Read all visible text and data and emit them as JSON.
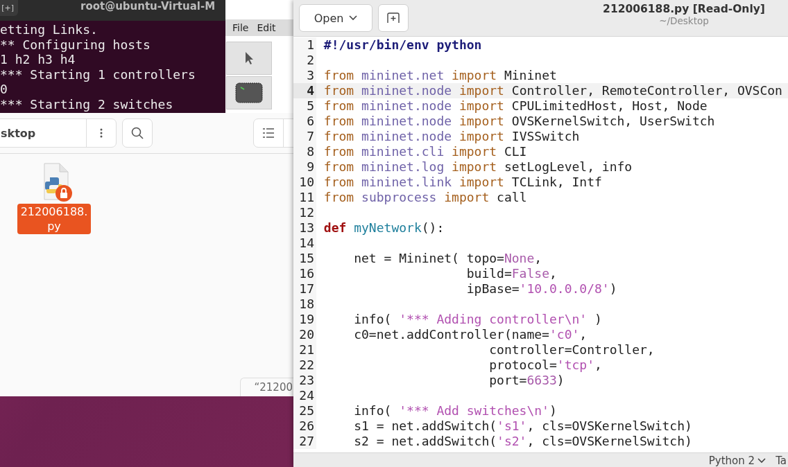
{
  "terminal": {
    "title": "root@ubuntu-Virtual-M",
    "new_tab_button": "[+]",
    "lines": [
      "etting Links.",
      "** Configuring hosts",
      "1 h2 h3 h4",
      "*** Starting 1 controllers",
      "0",
      "*** Starting 2 switches"
    ]
  },
  "miniedit": {
    "menu": [
      "File",
      "Edit"
    ],
    "tools": [
      {
        "kind": "select",
        "selected": false
      },
      {
        "kind": "switch",
        "selected": false
      }
    ]
  },
  "file_manager": {
    "path": "sktop",
    "files": [
      {
        "name": "212006188.\npy",
        "selected": true,
        "locked": true
      }
    ],
    "status_overlay": "“21200"
  },
  "editor": {
    "open_button": "Open",
    "title": "212006188.py [Read-Only]",
    "subtitle": "~/Desktop",
    "lines": [
      {
        "number": "1",
        "current": false,
        "segments": [
          {
            "kind": "shebang",
            "text": "#!/usr/bin/env python"
          }
        ]
      },
      {
        "number": "2",
        "current": false
      },
      {
        "number": "3",
        "current": false,
        "segments": [
          {
            "kind": "keyword",
            "text": "from"
          },
          {
            "kind": "module",
            "text": " mininet.net"
          },
          {
            "kind": "keyword",
            "text": " import"
          },
          {
            "kind": "plain",
            "text": " Mininet"
          }
        ]
      },
      {
        "number": "4",
        "current": true,
        "segments": [
          {
            "kind": "keyword",
            "text": "from"
          },
          {
            "kind": "module",
            "text": " mininet.node"
          },
          {
            "kind": "keyword",
            "text": " import"
          },
          {
            "kind": "plain",
            "text": " Controller, RemoteController, OVSCon"
          }
        ]
      },
      {
        "number": "5",
        "current": false,
        "segments": [
          {
            "kind": "keyword",
            "text": "from"
          },
          {
            "kind": "module",
            "text": " mininet.node"
          },
          {
            "kind": "keyword",
            "text": " import"
          },
          {
            "kind": "plain",
            "text": " CPULimitedHost, Host, Node"
          }
        ]
      },
      {
        "number": "6",
        "current": false,
        "segments": [
          {
            "kind": "keyword",
            "text": "from"
          },
          {
            "kind": "module",
            "text": " mininet.node"
          },
          {
            "kind": "keyword",
            "text": " import"
          },
          {
            "kind": "plain",
            "text": " OVSKernelSwitch, UserSwitch"
          }
        ]
      },
      {
        "number": "7",
        "current": false,
        "segments": [
          {
            "kind": "keyword",
            "text": "from"
          },
          {
            "kind": "module",
            "text": " mininet.node"
          },
          {
            "kind": "keyword",
            "text": " import"
          },
          {
            "kind": "plain",
            "text": " IVSSwitch"
          }
        ]
      },
      {
        "number": "8",
        "current": false,
        "segments": [
          {
            "kind": "keyword",
            "text": "from"
          },
          {
            "kind": "module",
            "text": " mininet.cli"
          },
          {
            "kind": "keyword",
            "text": " import"
          },
          {
            "kind": "plain",
            "text": " CLI"
          }
        ]
      },
      {
        "number": "9",
        "current": false,
        "segments": [
          {
            "kind": "keyword",
            "text": "from"
          },
          {
            "kind": "module",
            "text": " mininet.log"
          },
          {
            "kind": "keyword",
            "text": " import"
          },
          {
            "kind": "plain",
            "text": " setLogLevel, info"
          }
        ]
      },
      {
        "number": "10",
        "current": false,
        "segments": [
          {
            "kind": "keyword",
            "text": "from"
          },
          {
            "kind": "module",
            "text": " mininet.link"
          },
          {
            "kind": "keyword",
            "text": " import"
          },
          {
            "kind": "plain",
            "text": " TCLink, Intf"
          }
        ]
      },
      {
        "number": "11",
        "current": false,
        "segments": [
          {
            "kind": "keyword",
            "text": "from"
          },
          {
            "kind": "module",
            "text": " subprocess"
          },
          {
            "kind": "keyword",
            "text": " import"
          },
          {
            "kind": "plain",
            "text": " call"
          }
        ]
      },
      {
        "number": "12",
        "current": false
      },
      {
        "number": "13",
        "current": false,
        "segments": [
          {
            "kind": "def",
            "text": "def"
          },
          {
            "kind": "function",
            "text": " myNetwork"
          },
          {
            "kind": "plain",
            "text": "():"
          }
        ]
      },
      {
        "number": "14",
        "current": false
      },
      {
        "number": "15",
        "current": false,
        "segments": [
          {
            "kind": "plain",
            "text": "    net = Mininet( topo="
          },
          {
            "kind": "constant",
            "text": "None"
          },
          {
            "kind": "plain",
            "text": ","
          }
        ]
      },
      {
        "number": "16",
        "current": false,
        "segments": [
          {
            "kind": "plain",
            "text": "                   build="
          },
          {
            "kind": "constant",
            "text": "False"
          },
          {
            "kind": "plain",
            "text": ","
          }
        ]
      },
      {
        "number": "17",
        "current": false,
        "segments": [
          {
            "kind": "plain",
            "text": "                   ipBase="
          },
          {
            "kind": "string",
            "text": "'10.0.0.0/8'"
          },
          {
            "kind": "plain",
            "text": ")"
          }
        ]
      },
      {
        "number": "18",
        "current": false
      },
      {
        "number": "19",
        "current": false,
        "segments": [
          {
            "kind": "plain",
            "text": "    info( "
          },
          {
            "kind": "string",
            "text": "'*** Adding controller\\n'"
          },
          {
            "kind": "plain",
            "text": " )"
          }
        ]
      },
      {
        "number": "20",
        "current": false,
        "segments": [
          {
            "kind": "plain",
            "text": "    c0=net.addController(name="
          },
          {
            "kind": "string",
            "text": "'c0'"
          },
          {
            "kind": "plain",
            "text": ","
          }
        ]
      },
      {
        "number": "21",
        "current": false,
        "segments": [
          {
            "kind": "plain",
            "text": "                      controller=Controller,"
          }
        ]
      },
      {
        "number": "22",
        "current": false,
        "segments": [
          {
            "kind": "plain",
            "text": "                      protocol="
          },
          {
            "kind": "string",
            "text": "'tcp'"
          },
          {
            "kind": "plain",
            "text": ","
          }
        ]
      },
      {
        "number": "23",
        "current": false,
        "segments": [
          {
            "kind": "plain",
            "text": "                      port="
          },
          {
            "kind": "constant",
            "text": "6633"
          },
          {
            "kind": "plain",
            "text": ")"
          }
        ]
      },
      {
        "number": "24",
        "current": false
      },
      {
        "number": "25",
        "current": false,
        "segments": [
          {
            "kind": "plain",
            "text": "    info( "
          },
          {
            "kind": "string",
            "text": "'*** Add switches\\n'"
          },
          {
            "kind": "plain",
            "text": ")"
          }
        ]
      },
      {
        "number": "26",
        "current": false,
        "segments": [
          {
            "kind": "plain",
            "text": "    s1 = net.addSwitch("
          },
          {
            "kind": "string",
            "text": "'s1'"
          },
          {
            "kind": "plain",
            "text": ", cls=OVSKernelSwitch)"
          }
        ]
      },
      {
        "number": "27",
        "current": false,
        "segments": [
          {
            "kind": "plain",
            "text": "    s2 = net.addSwitch("
          },
          {
            "kind": "string",
            "text": "'s2'"
          },
          {
            "kind": "plain",
            "text": ", cls=OVSKernelSwitch)"
          }
        ]
      }
    ],
    "status_bar": {
      "language": "Python 2",
      "tab_width": "Ta"
    }
  }
}
